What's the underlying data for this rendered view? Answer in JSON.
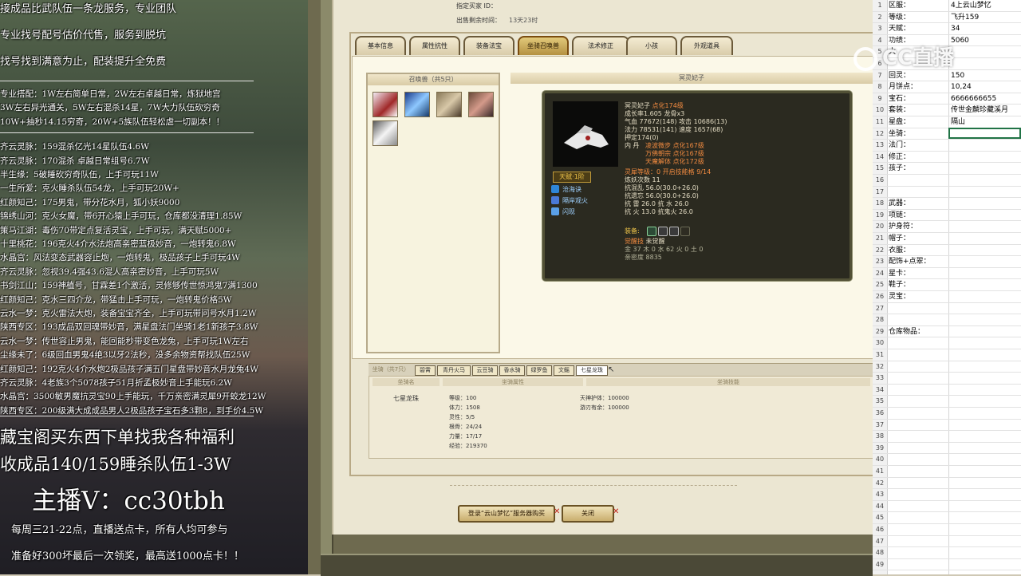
{
  "stream_overlay": {
    "lines_top": [
      "接成品比武队伍一条龙服务，专业团队",
      "专业找号配号估价代售，服务到脱坑",
      "找号找到满意为止，配装提升全免费"
    ],
    "lines_small": [
      "专业搭配：1W左右简单日常，2W左右卓越日常，炼狱地宫",
      "3W左右异光通关，5W左右混杀14星，7W大力队伍砍穷奇",
      "10W+抽秒14.15穷奇，20W+5族队伍轻松虐一切副本！！",
      "齐云灵脉：159混杀亿光14星队伍4.6W",
      "齐云灵脉：170混杀 卓越日常组号6.7W",
      "半生缘：5破睡砍穷奇队伍，上手可玩11W",
      "一生所爱：克火睡杀队伍54龙，上手可玩20W+",
      "红颜知己：175男鬼，带分花水月，狐小妖9000",
      "锦绣山河：克火女魔，带6开心猿上手可玩，仓库都没清理1.85W",
      "策马江湖：毒伤70带定点复活灵宝，上手可玩，满天赋5000+",
      "十里桃花：196克火4介水法炮高亲密蓝极妙音，一炮转鬼6.8W",
      "水晶宫：风法变态武器容止炮，一炮转鬼，极品孩子上手可玩4W",
      "齐云灵脉：忽视39.4强43.6混人高亲密妙音，上手可玩5W",
      "书剑江山：159神植号，甘霖差1个激活，灵修够传世惊鸿鬼7满1300",
      "红颜知己：克水三四介龙，带猛击上手可玩，一炮转鬼价格5W",
      "云水一梦：克火雷法大炮，装备宝宝齐全，上手可玩带问号水月1.2W",
      "陕西专区：193成品双回魂带妙音，满星盘法门坐骑1老1新孩子3.8W",
      "云水一梦：传世容止男鬼，能回能秒带变色龙兔，上手可玩1W左右",
      "尘缘未了：6级回血男鬼4绝3以牙2法秒，没多余物资帮找队伍25W",
      "红颜知己：192克火4介水炮2极品孩子满五门星盘带妙音水月龙兔4W",
      "齐云灵脉：4老族3个5078孩子51月折孟极妙音上手能玩6.2W",
      "水晶宫：3500敏男魔抗灵宝90上手能玩，千万亲密满灵犀9开蛟龙12W",
      "陕西专区：200级满大成成品男人2极品孩子宝石多3颗8，到手价4.5W"
    ],
    "lines_bottom_1": "藏宝阁买东西下单找我各种福利",
    "lines_bottom_2": "收成品140/159睡杀队伍1-3W",
    "anchor": "主播V：cc30tbh",
    "lines_bottom_3": "每周三21-22点，直播送点卡，所有人均可参与",
    "lines_bottom_4": "准备好300坏最后一次领奖，最高送1000点卡！！"
  },
  "game": {
    "sale_buyer_label": "指定买家 ID：",
    "sale_time_label": "出售剩余时间：",
    "sale_time_value": "13天23时",
    "tabs": [
      "基本信息",
      "属性抗性",
      "装备法宝",
      "坐骑召唤兽",
      "法术修正",
      "小孩",
      "外观道具"
    ],
    "summon_list_title": "召唤兽（共5只）",
    "detail_title": "冥灵妃子",
    "pet": {
      "name": "冥灵妃子",
      "evo": "点化174级",
      "growth": "成长率1.605 龙骨x3",
      "hp_label": "气血",
      "hp": "77672(148)",
      "atk_label": "攻击",
      "atk": "10686(13)",
      "mp_label": "法力",
      "mp": "78531(141)",
      "spd_label": "速度",
      "spd": "1657(68)",
      "bind": "押定174(0)",
      "neidan_label": "内  丹",
      "neidan_1": "凌波微步",
      "neidan_1_lv": "点化167级",
      "neidan_2": "万佛朝宗",
      "neidan_2_lv": "点化167级",
      "neidan_3": "天魔解体",
      "neidan_3_lv": "点化172级",
      "spirit_label": "灵犀等级：",
      "spirit_level": "0",
      "spirit_open": "开启技能格",
      "spirit_slots": "9/14",
      "practice": "炼妖次数 11",
      "res_1_label": "抗混乱",
      "res_1": "56.0(30.0+26.0)",
      "res_2_label": "抗遗忘",
      "res_2": "56.0(30.0+26.0)",
      "res_3_label": "抗  雷",
      "res_3": "26.0",
      "res_4_label": "抗  水",
      "res_4": "26.0",
      "res_5_label": "抗  火",
      "res_5": "13.0",
      "res_6_label": "抗鬼火",
      "res_6": "26.0",
      "equip_label": "装备:",
      "awaken_label": "觉醒技",
      "awaken_value": "未觉醒",
      "wuxing": "金 37 木 0 水 62 火 0 土 0",
      "intimacy": "亲密度 8835",
      "badge": "天赋·1阶",
      "skills": [
        "沧海诀",
        "隔岸观火",
        "闪现"
      ]
    },
    "bottom_tabs": [
      "坐骑（共7只）",
      "碧霄",
      "青丹火马",
      "云豆骑",
      "香水骑",
      "绿罗鱼",
      "文鳐",
      "七星龙珠"
    ],
    "mount_col_1": "坐骑名",
    "mount_col_2": "坐骑属性",
    "mount_col_3": "坐骑技能",
    "mount": {
      "name": "七星龙珠",
      "level_label": "等级：",
      "level": "100",
      "hp_label": "体力：",
      "hp": "1508",
      "spirit_label": "灵性：",
      "spirit": "5/5",
      "root_label": "根骨：",
      "root": "24/24",
      "power_label": "力量：",
      "power": "17/17",
      "exp_label": "经验：",
      "exp": "219370",
      "skill_1_label": "天神护体：",
      "skill_1": "100000",
      "skill_2_label": "游刃有余：",
      "skill_2": "100000"
    },
    "buttons": {
      "login": "登录“云山梦忆”服务器购买",
      "close": "关闭"
    }
  },
  "sheet": {
    "rows": [
      {
        "n": "1",
        "a": "区服：",
        "b": "4上云山梦忆"
      },
      {
        "n": "2",
        "a": "等级：",
        "b": "飞升159"
      },
      {
        "n": "3",
        "a": "天赋：",
        "b": "34"
      },
      {
        "n": "4",
        "a": "功绩：",
        "b": "5060"
      },
      {
        "n": "5",
        "a": "大",
        "b": ""
      },
      {
        "n": "6",
        "a": "",
        "b": ""
      },
      {
        "n": "7",
        "a": "回灵：",
        "b": "150"
      },
      {
        "n": "8",
        "a": "月饼点：",
        "b": "10,24"
      },
      {
        "n": "9",
        "a": "宝石：",
        "b": "6666666655"
      },
      {
        "n": "10",
        "a": "套装：",
        "b": "传世金麟珍藏溪月"
      },
      {
        "n": "11",
        "a": "星盘：",
        "b": "隔山"
      },
      {
        "n": "12",
        "a": "坐骑：",
        "b": ""
      },
      {
        "n": "13",
        "a": "法门：",
        "b": ""
      },
      {
        "n": "14",
        "a": "修正：",
        "b": ""
      },
      {
        "n": "15",
        "a": "孩子：",
        "b": ""
      },
      {
        "n": "16",
        "a": "",
        "b": ""
      },
      {
        "n": "17",
        "a": "",
        "b": ""
      },
      {
        "n": "18",
        "a": "武器：",
        "b": ""
      },
      {
        "n": "19",
        "a": "项链：",
        "b": ""
      },
      {
        "n": "20",
        "a": "护身符：",
        "b": ""
      },
      {
        "n": "21",
        "a": "帽子：",
        "b": ""
      },
      {
        "n": "22",
        "a": "衣服：",
        "b": ""
      },
      {
        "n": "23",
        "a": "配饰+点翠：",
        "b": ""
      },
      {
        "n": "24",
        "a": "星卡：",
        "b": ""
      },
      {
        "n": "25",
        "a": "鞋子：",
        "b": ""
      },
      {
        "n": "26",
        "a": "灵宝：",
        "b": ""
      },
      {
        "n": "27",
        "a": "",
        "b": ""
      },
      {
        "n": "28",
        "a": "",
        "b": ""
      },
      {
        "n": "29",
        "a": "仓库物品：",
        "b": ""
      },
      {
        "n": "30",
        "a": "",
        "b": ""
      },
      {
        "n": "31",
        "a": "",
        "b": ""
      },
      {
        "n": "32",
        "a": "",
        "b": ""
      },
      {
        "n": "33",
        "a": "",
        "b": ""
      },
      {
        "n": "34",
        "a": "",
        "b": ""
      },
      {
        "n": "35",
        "a": "",
        "b": ""
      },
      {
        "n": "36",
        "a": "",
        "b": ""
      },
      {
        "n": "37",
        "a": "",
        "b": ""
      },
      {
        "n": "38",
        "a": "",
        "b": ""
      },
      {
        "n": "39",
        "a": "",
        "b": ""
      },
      {
        "n": "40",
        "a": "",
        "b": ""
      },
      {
        "n": "41",
        "a": "",
        "b": ""
      },
      {
        "n": "42",
        "a": "",
        "b": ""
      },
      {
        "n": "43",
        "a": "",
        "b": ""
      },
      {
        "n": "44",
        "a": "",
        "b": ""
      },
      {
        "n": "45",
        "a": "",
        "b": ""
      },
      {
        "n": "46",
        "a": "",
        "b": ""
      },
      {
        "n": "47",
        "a": "",
        "b": ""
      },
      {
        "n": "48",
        "a": "",
        "b": ""
      },
      {
        "n": "49",
        "a": "",
        "b": ""
      }
    ]
  },
  "watermark": "CC直播",
  "colors": {
    "accent_orange": "#f08a40",
    "gold": "#f1c64a",
    "sheet_select": "#217346"
  }
}
